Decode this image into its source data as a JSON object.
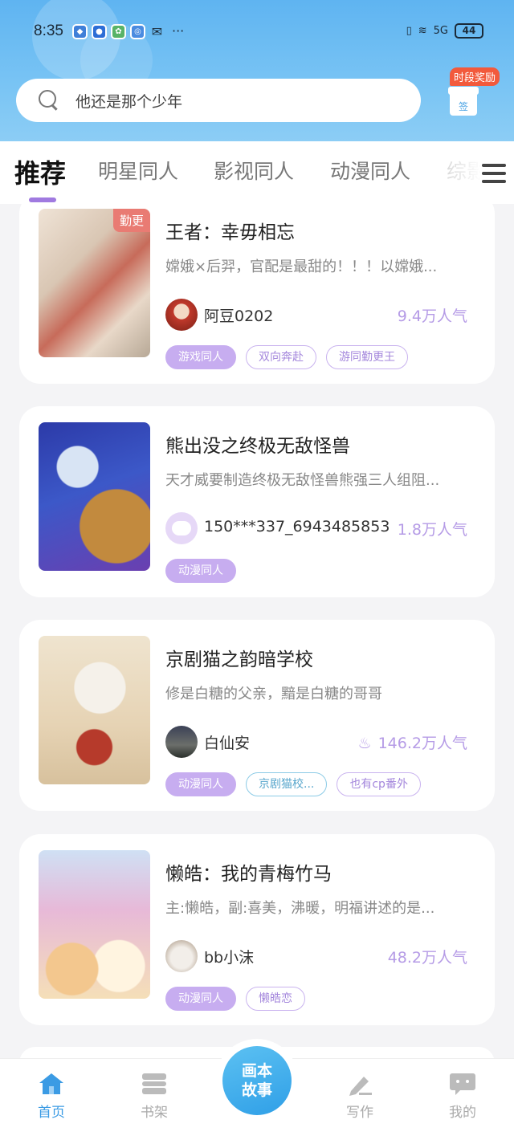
{
  "status_bar": {
    "time": "8:35",
    "more": "···",
    "network": "5G",
    "battery": "44"
  },
  "search": {
    "placeholder": "他还是那个少年"
  },
  "gift": {
    "badge": "时段奖励",
    "label": "签"
  },
  "tabs": [
    "推荐",
    "明星同人",
    "影视同人",
    "动漫同人",
    "综影"
  ],
  "cards": [
    {
      "title": "王者：幸毋相忘",
      "desc": "嫦娥×后羿，官配是最甜的！！！以嫦娥...",
      "author": "阿豆0202",
      "popularity": "9.4万人气",
      "badge": "勤更",
      "tags": [
        "游戏同人",
        "双向奔赴",
        "游同勤更王"
      ]
    },
    {
      "title": "熊出没之终极无敌怪兽",
      "desc": "天才威要制造终极无敌怪兽熊强三人组阻...",
      "author": "150***337_6943485853",
      "popularity": "1.8万人气",
      "tags": [
        "动漫同人"
      ]
    },
    {
      "title": "京剧猫之韵暗学校",
      "desc": "修是白糖的父亲，黯是白糖的哥哥",
      "author": "白仙安",
      "popularity": "146.2万人气",
      "tags": [
        "动漫同人",
        "京剧猫校...",
        "也有cp番外"
      ]
    },
    {
      "title": "懒皓：我的青梅竹马",
      "desc": "主:懒皓，副:喜美，沸暖，明福讲述的是...",
      "author": "bb小沫",
      "popularity": "48.2万人气",
      "tags": [
        "动漫同人",
        "懒皓恋"
      ]
    }
  ],
  "nav": {
    "home": "首页",
    "shelf": "书架",
    "center": [
      "画本",
      "故事"
    ],
    "write": "写作",
    "mine": "我的"
  },
  "colors": {
    "accent": "#3b9be4",
    "purple": "#b59be6",
    "header": "#6fbef3"
  }
}
